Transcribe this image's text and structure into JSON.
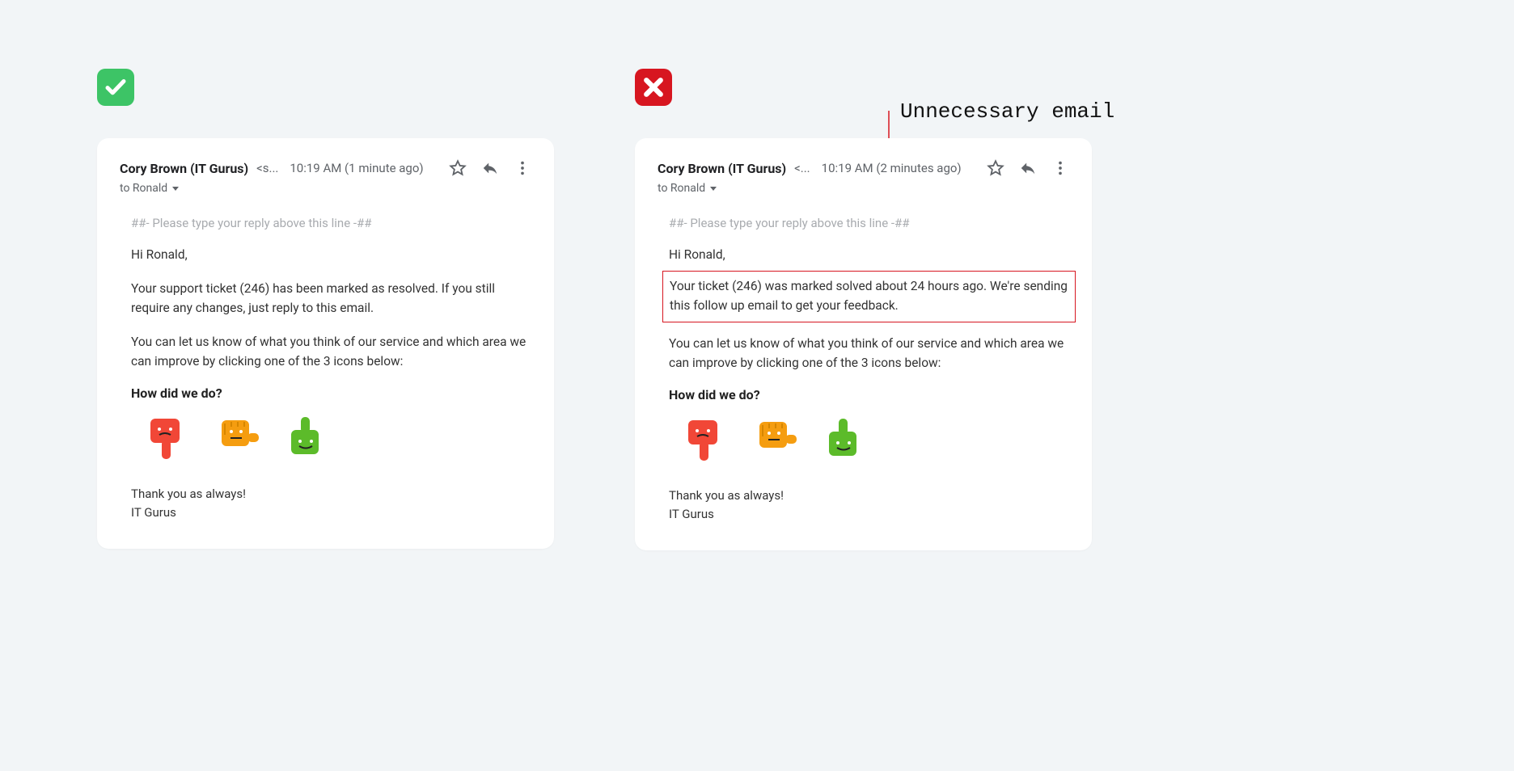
{
  "good": {
    "sender": "Cory Brown (IT Gurus)",
    "sender_trunc": "<s...",
    "time": "10:19 AM (1 minute ago)",
    "to": "to Ronald",
    "reply_line": "##- Please type your reply above this line -##",
    "greeting": "Hi Ronald,",
    "p1": "Your support ticket (246) has been marked as resolved. If you still require any changes, just reply to this email.",
    "p2": "You can let us know of what you think of our service and which area we can improve by clicking one of the 3 icons below:",
    "hdwd": "How did we do?",
    "signoff1": "Thank you as always!",
    "signoff2": "IT Gurus"
  },
  "bad": {
    "sender": "Cory Brown (IT Gurus)",
    "sender_trunc": "<...",
    "time": "10:19 AM (2 minutes ago)",
    "to": "to Ronald",
    "reply_line": "##- Please type your reply above this line -##",
    "greeting": "Hi Ronald,",
    "p1": "Your ticket (246) was marked solved about 24 hours ago. We're sending this follow up email to get your feedback.",
    "p2": "You can let us know of what you think of our service and which area we can improve by clicking one of the 3 icons below:",
    "hdwd": "How did we do?",
    "signoff1": "Thank you as always!",
    "signoff2": "IT Gurus"
  },
  "callout": "Unnecessary email"
}
